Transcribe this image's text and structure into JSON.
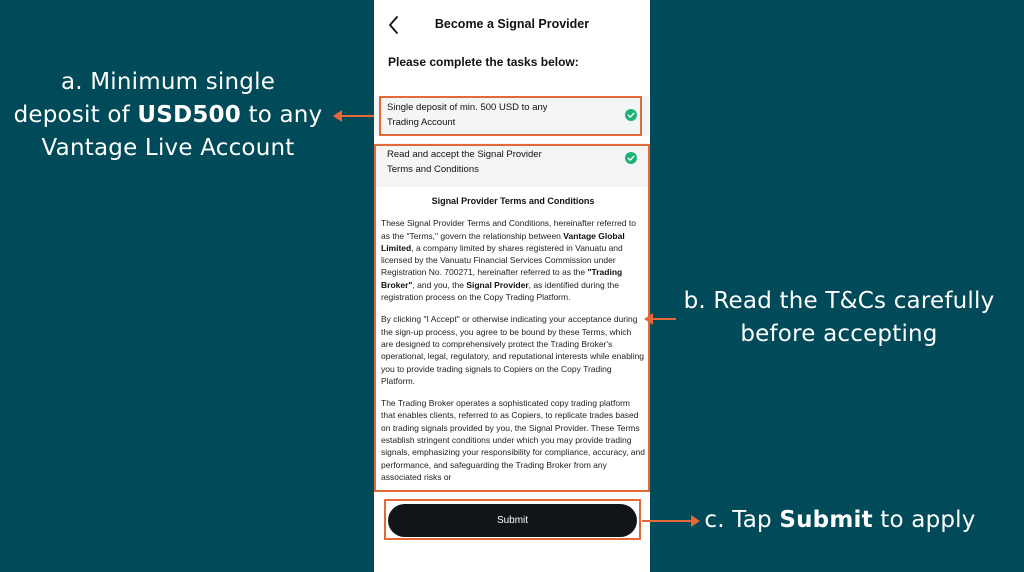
{
  "annotations": {
    "a": {
      "line1": "a. Minimum single",
      "prefix": "deposit of ",
      "bold": "USD500",
      "suffix": " to any",
      "line3": "Vantage Live Account"
    },
    "b": {
      "line1": "b. Read the T&Cs carefully",
      "line2": "before accepting"
    },
    "c": {
      "prefix": "c. Tap ",
      "bold": "Submit",
      "suffix": " to apply"
    }
  },
  "screen": {
    "title": "Become a Signal Provider",
    "back_icon": "chevron-left-icon",
    "intro": "Please complete the tasks below:",
    "tasks": [
      {
        "line1": "Single deposit of min. 500 USD to any",
        "line2": "Trading Account",
        "status_icon": "check-circle-icon",
        "status_color": "#1fb277"
      },
      {
        "line1": "Read and accept the Signal Provider",
        "line2": "Terms and Conditions",
        "status_icon": "check-circle-icon",
        "status_color": "#1fb277"
      }
    ],
    "terms": {
      "title": "Signal Provider Terms and Conditions",
      "p1": {
        "t1": "These Signal Provider Terms and Conditions, hereinafter referred to as the \"Terms,\" govern the relationship between ",
        "b1": "Vantage Global Limited",
        "t2": ", a company limited by shares registered in Vanuatu and licensed by the Vanuatu Financial Services Commission under Registration No. 700271, hereinafter referred to as the ",
        "b2": "\"Trading Broker\"",
        "t3": ", and you, the ",
        "b3": "Signal Provider",
        "t4": ", as identified during the registration process on the Copy Trading Platform."
      },
      "p2": "By clicking \"I Accept\" or otherwise indicating your acceptance during the sign-up process, you agree to be bound by these Terms, which are designed to comprehensively protect the Trading Broker's operational, legal, regulatory, and reputational interests while enabling you to provide trading signals to Copiers on the Copy Trading Platform.",
      "p3": "The Trading Broker operates a sophisticated copy trading platform that enables clients, referred to as Copiers, to replicate trades based on trading signals provided by you, the Signal Provider. These Terms establish stringent conditions under which you may provide trading signals, emphasizing your responsibility for compliance, accuracy, and performance, and safeguarding the Trading Broker from any associated risks or"
    },
    "submit_label": "Submit"
  },
  "colors": {
    "background": "#004a59",
    "highlight": "#e36a36",
    "button": "#111418"
  }
}
